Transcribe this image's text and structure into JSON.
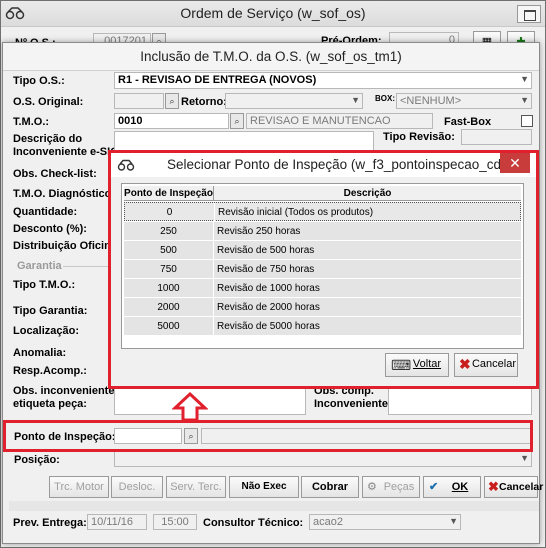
{
  "outer": {
    "title": "Ordem de Serviço (w_sof_os)",
    "nos_label": "Nº O.S.:",
    "nos_value": "0017201",
    "preordem_label": "Pré-Ordem:",
    "preordem_value": "0"
  },
  "dialog": {
    "title": "Inclusão de T.M.O. da O.S. (w_sof_os_tm1)",
    "tipo_os_label": "Tipo O.S.:",
    "tipo_os_value": "R1 - REVISAO DE ENTREGA (NOVOS)",
    "os_original_label": "O.S. Original:",
    "retorno_label": "Retorno:",
    "box_label": "BOX:",
    "box_value": "<NENHUM>",
    "tmo_label": "T.M.O.:",
    "tmo_code": "0010",
    "tmo_desc": "REVISAO E MANUTENCAO",
    "fastbox_label": "Fast-Box",
    "descricao_label": "Descrição do",
    "inconveniente_label": "Inconveniente e-SIG:",
    "tipo_revisao_label": "Tipo Revisão:",
    "obs_checklist_label": "Obs. Check-list:",
    "tmo_diag_label": "T.M.O. Diagnóstico:",
    "quantidade_label": "Quantidade:",
    "desconto_label": "Desconto (%):",
    "distribuicao_label": "Distribuição Oficina:",
    "garantia_label": "Garantia",
    "tipo_tmo_label": "Tipo T.M.O.:",
    "tipo_garantia_label": "Tipo Garantia:",
    "localizacao_label": "Localização:",
    "anomalia_label": "Anomalia:",
    "resp_acomp_label": "Resp.Acomp.:",
    "obs_inconv_label1": "Obs. inconveniente",
    "obs_inconv_label2": "etiqueta peça:",
    "obs_comp_label1": "Obs. comp.",
    "obs_comp_label2": "Inconveniente:",
    "ponto_label": "Ponto de Inspeção:",
    "posicao_label": "Posição:",
    "buttons": {
      "trc_motor": "Trc. Motor",
      "desloc": "Desloc.",
      "serv_terc": "Serv. Terc.",
      "nao_exec": "Não Exec Serv",
      "cobrar": "Cobrar",
      "pecas": "Peças",
      "ok": "OK",
      "cancelar": "Cancelar"
    },
    "prev_entrega_label": "Prev. Entrega:",
    "prev_entrega_date": "10/11/16",
    "prev_entrega_time": "15:00",
    "consultor_label": "Consultor Técnico:",
    "consultor_value": "acao2"
  },
  "lookup": {
    "title": "Selecionar Ponto de Inspeção (w_f3_pontoinspecao_cd)",
    "col1": "Ponto de Inspeção",
    "col2": "Descrição",
    "rows": [
      {
        "ponto": "0",
        "desc": "Revisão inicial (Todos os produtos)"
      },
      {
        "ponto": "250",
        "desc": "Revisão 250 horas"
      },
      {
        "ponto": "500",
        "desc": "Revisão de 500 horas"
      },
      {
        "ponto": "750",
        "desc": "Revisão de 750 horas"
      },
      {
        "ponto": "1000",
        "desc": "Revisão de 1000 horas"
      },
      {
        "ponto": "2000",
        "desc": "Revisão de 2000 horas"
      },
      {
        "ponto": "5000",
        "desc": "Revisão de 5000 horas"
      }
    ],
    "voltar": "Voltar",
    "cancelar": "Cancelar"
  },
  "colors": {
    "highlight": "#e0202c"
  }
}
